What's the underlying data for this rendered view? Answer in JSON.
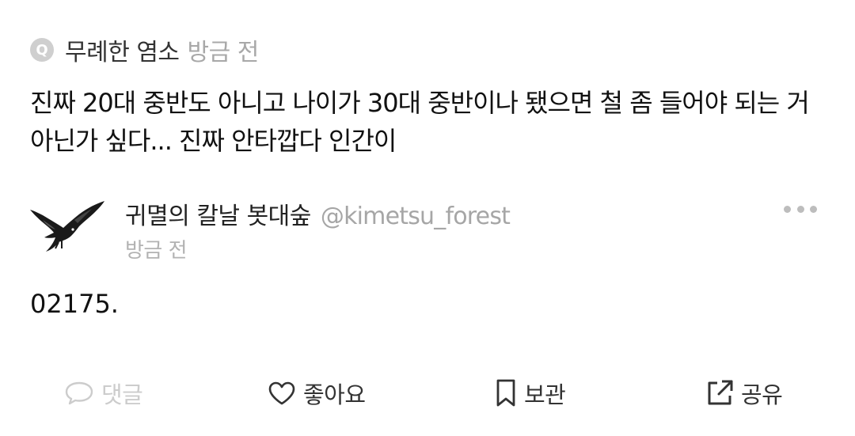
{
  "question": {
    "badge": "Q",
    "author": "무례한 염소",
    "time": "방금 전",
    "text": "진짜 20대 중반도 아니고 나이가 30대 중반이나 됐으면 철 좀 들어야 되는 거 아닌가 싶다... 진짜 안타깝다 인간이"
  },
  "reply": {
    "avatar_icon": "crow-icon",
    "name": "귀멸의 칼날 봇대숲",
    "handle": "@kimetsu_forest",
    "time": "방금 전",
    "more_icon": "more-dots-icon",
    "text": "02175."
  },
  "actions": {
    "comment": {
      "label": "댓글",
      "icon": "comment-icon",
      "disabled": true
    },
    "like": {
      "label": "좋아요",
      "icon": "heart-icon"
    },
    "save": {
      "label": "보관",
      "icon": "bookmark-icon"
    },
    "share": {
      "label": "공유",
      "icon": "share-icon"
    }
  },
  "colors": {
    "text": "#111111",
    "muted": "#a8a8a8",
    "disabled": "#cccccc",
    "badge": "#cfcfcf"
  }
}
